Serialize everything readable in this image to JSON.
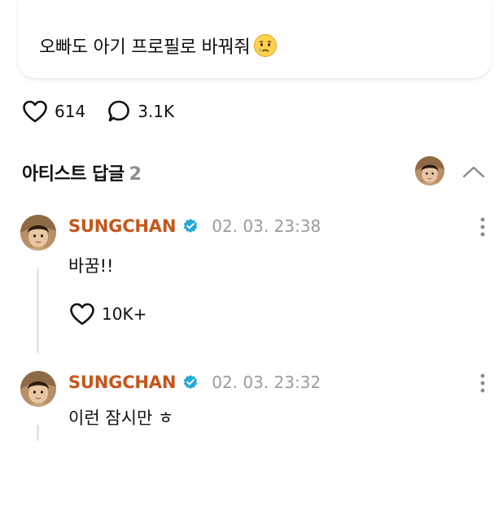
{
  "post": {
    "text": "오빠도 아기 프로필로 바꿔줘",
    "emoji": "crying-face-emoji"
  },
  "stats": {
    "likes": "614",
    "comments": "3.1K"
  },
  "artist_replies": {
    "title": "아티스트 답글",
    "count": "2"
  },
  "comments": [
    {
      "author": "SUNGCHAN",
      "timestamp": "02. 03. 23:38",
      "text": "바꿈!!",
      "likes": "10K+"
    },
    {
      "author": "SUNGCHAN",
      "timestamp": "02. 03. 23:32",
      "text": "이런 잠시만 ㅎ"
    }
  ],
  "colors": {
    "author": "#c4561c",
    "verified_badge": "#25a9d6",
    "muted": "#8e8e8e",
    "thread_line": "#e4e4e4"
  },
  "icons": {
    "like": "heart-outline-icon",
    "comment": "speech-bubble-icon",
    "verified": "verified-badge-icon",
    "collapse": "chevron-up-icon",
    "more": "more-vertical-icon"
  }
}
